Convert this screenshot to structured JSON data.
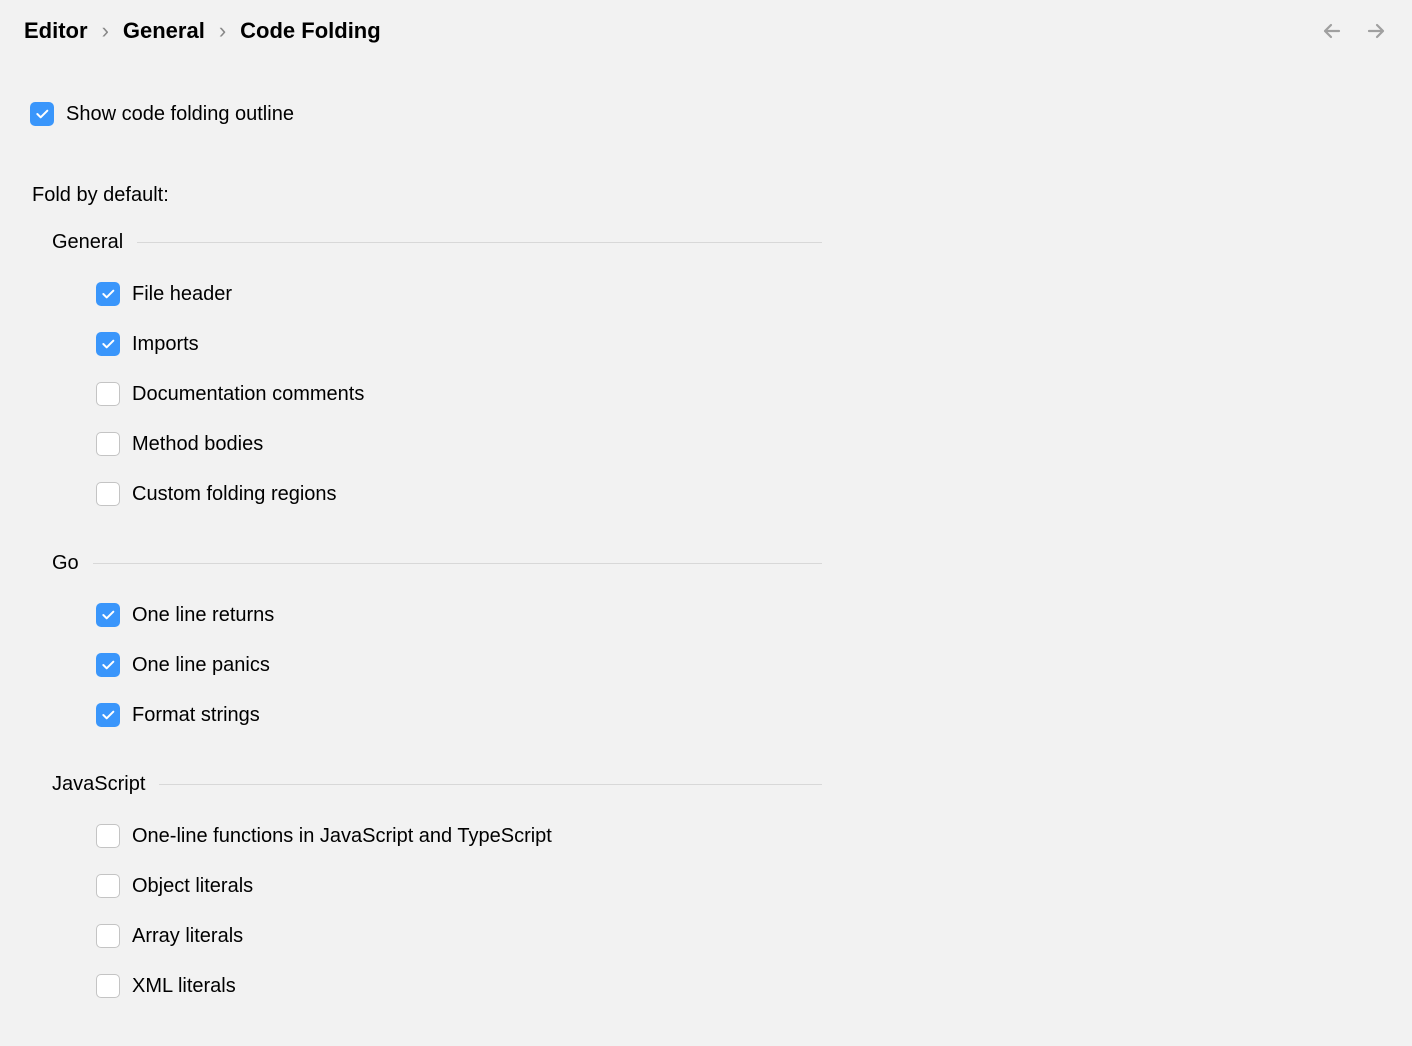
{
  "breadcrumb": {
    "items": [
      "Editor",
      "General",
      "Code Folding"
    ]
  },
  "show_outline": {
    "label": "Show code folding outline",
    "checked": true
  },
  "fold_by_default_label": "Fold by default:",
  "groups": [
    {
      "title": "General",
      "items": [
        {
          "label": "File header",
          "checked": true
        },
        {
          "label": "Imports",
          "checked": true
        },
        {
          "label": "Documentation comments",
          "checked": false
        },
        {
          "label": "Method bodies",
          "checked": false
        },
        {
          "label": "Custom folding regions",
          "checked": false
        }
      ]
    },
    {
      "title": "Go",
      "items": [
        {
          "label": "One line returns",
          "checked": true
        },
        {
          "label": "One line panics",
          "checked": true
        },
        {
          "label": "Format strings",
          "checked": true
        }
      ]
    },
    {
      "title": "JavaScript",
      "items": [
        {
          "label": "One-line functions in JavaScript and TypeScript",
          "checked": false
        },
        {
          "label": "Object literals",
          "checked": false
        },
        {
          "label": "Array literals",
          "checked": false
        },
        {
          "label": "XML literals",
          "checked": false
        }
      ]
    }
  ]
}
